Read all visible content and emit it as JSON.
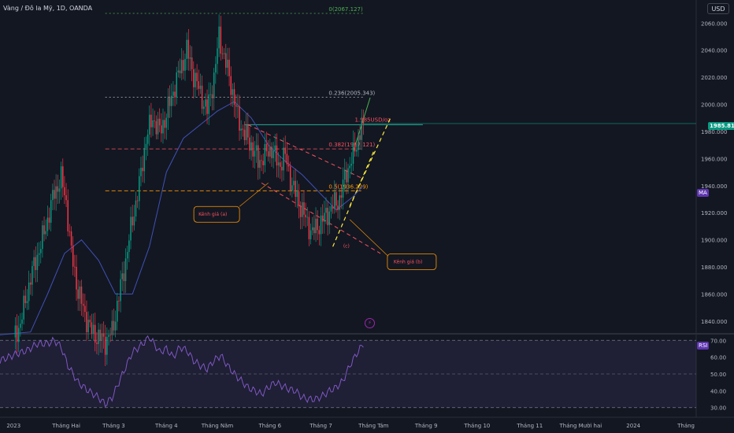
{
  "header": {
    "title": "Vàng / Đô la Mỹ, 1D, OANDA",
    "currency_button": "USD"
  },
  "badges": {
    "price": "1985.810",
    "ma": "MA",
    "rsi": "RSI"
  },
  "colors": {
    "background": "#131722",
    "up": "#089981",
    "down": "#f23645",
    "ma_line": "#3f51b5",
    "rsi_line": "#7e57c2",
    "fib": "#f7525f",
    "channel": "#ff9800",
    "rsi_band": "#2a2e39"
  },
  "chart_data": [
    {
      "type": "candlestick",
      "title": "Vàng / Đô la Mỹ, 1D, OANDA",
      "y_ticks": [
        1840,
        1860,
        1880,
        1900,
        1920,
        1940,
        1960,
        1980,
        2000,
        2020,
        2040,
        2060
      ],
      "y_tick_labels": [
        "1840.000",
        "1860.000",
        "1880.000",
        "1900.000",
        "1920.000",
        "1940.000",
        "1960.000",
        "1980.000",
        "2000.000",
        "2020.000",
        "2040.000",
        "2060.000"
      ],
      "ylim": [
        1833,
        2077
      ],
      "x_tick_labels": [
        "2023",
        "Tháng Hai",
        "Tháng 3",
        "Tháng 4",
        "Tháng Năm",
        "Tháng 6",
        "Tháng 7",
        "Tháng Tám",
        "Tháng 9",
        "Tháng 10",
        "Tháng 11",
        "Tháng Mười hai",
        "2024",
        "Tháng"
      ],
      "x_tick_days": [
        0,
        31,
        59,
        90,
        120,
        151,
        181,
        212,
        243,
        273,
        304,
        334,
        365,
        396
      ],
      "xlim": [
        -8,
        402
      ],
      "last_day": 206,
      "last_price": 1985.81,
      "price_anchors": [
        [
          0,
          1828
        ],
        [
          4,
          1838
        ],
        [
          10,
          1872
        ],
        [
          18,
          1905
        ],
        [
          24,
          1935
        ],
        [
          28,
          1945
        ],
        [
          31,
          1928
        ],
        [
          34,
          1890
        ],
        [
          38,
          1862
        ],
        [
          42,
          1845
        ],
        [
          46,
          1832
        ],
        [
          50,
          1828
        ],
        [
          54,
          1825
        ],
        [
          58,
          1832
        ],
        [
          62,
          1858
        ],
        [
          66,
          1885
        ],
        [
          70,
          1915
        ],
        [
          74,
          1940
        ],
        [
          78,
          1975
        ],
        [
          82,
          1990
        ],
        [
          86,
          1980
        ],
        [
          90,
          1992
        ],
        [
          94,
          2010
        ],
        [
          98,
          2025
        ],
        [
          102,
          2040
        ],
        [
          106,
          2022
        ],
        [
          110,
          2008
        ],
        [
          114,
          1995
        ],
        [
          118,
          2020
        ],
        [
          121,
          2050
        ],
        [
          124,
          2035
        ],
        [
          128,
          2015
        ],
        [
          132,
          1990
        ],
        [
          136,
          1978
        ],
        [
          140,
          1970
        ],
        [
          144,
          1958
        ],
        [
          148,
          1962
        ],
        [
          152,
          1968
        ],
        [
          156,
          1955
        ],
        [
          160,
          1962
        ],
        [
          164,
          1940
        ],
        [
          168,
          1928
        ],
        [
          172,
          1915
        ],
        [
          176,
          1905
        ],
        [
          180,
          1912
        ],
        [
          184,
          1918
        ],
        [
          188,
          1925
        ],
        [
          192,
          1930
        ],
        [
          196,
          1950
        ],
        [
          200,
          1962
        ],
        [
          204,
          1980
        ],
        [
          206,
          1985.81
        ]
      ],
      "ma_anchors": [
        [
          -8,
          1830
        ],
        [
          10,
          1832
        ],
        [
          20,
          1860
        ],
        [
          30,
          1890
        ],
        [
          40,
          1900
        ],
        [
          50,
          1885
        ],
        [
          60,
          1860
        ],
        [
          70,
          1860
        ],
        [
          80,
          1895
        ],
        [
          90,
          1950
        ],
        [
          100,
          1975
        ],
        [
          110,
          1985
        ],
        [
          120,
          1995
        ],
        [
          130,
          2002
        ],
        [
          140,
          1990
        ],
        [
          150,
          1970
        ],
        [
          160,
          1958
        ],
        [
          170,
          1948
        ],
        [
          180,
          1935
        ],
        [
          190,
          1922
        ],
        [
          200,
          1932
        ],
        [
          206,
          1940
        ]
      ],
      "levels": [
        {
          "label": "0(2067.127)",
          "value": 2067.127,
          "day_from": 54,
          "day_to": 206,
          "color": "#4caf50",
          "style": "dotted"
        },
        {
          "label": "0.236(2005.343)",
          "value": 2005.343,
          "day_from": 54,
          "day_to": 206,
          "color": "#b2b5be",
          "style": "dotted"
        },
        {
          "label": "0.382(1967.121)",
          "value": 1967.121,
          "day_from": 54,
          "day_to": 206,
          "color": "#f7525f",
          "style": "dashed"
        },
        {
          "label": "0.5(1936.229)",
          "value": 1936.229,
          "day_from": 54,
          "day_to": 206,
          "color": "#ff9800",
          "style": "dashed"
        }
      ],
      "horizontal_line": {
        "label": "1.985USD/oz",
        "value": 1985.0,
        "day_from": 136,
        "day_to": 241
      },
      "annotations": [
        {
          "label": "Kênh giá (a)",
          "box_day": 108,
          "box_price": 1920
        },
        {
          "label": "Kênh giá (b)",
          "box_day": 222,
          "box_price": 1885
        },
        {
          "label": "(c)",
          "day": 196,
          "price": 1899
        }
      ]
    },
    {
      "type": "line",
      "name": "RSI",
      "y_ticks": [
        30,
        40,
        50,
        60,
        70
      ],
      "y_tick_labels": [
        "30.00",
        "40.00",
        "50.00",
        "60.00",
        "70.00"
      ],
      "ylim": [
        28,
        72
      ],
      "band": [
        30,
        70
      ],
      "rsi_anchors": [
        [
          -8,
          58
        ],
        [
          2,
          62
        ],
        [
          8,
          64
        ],
        [
          14,
          68
        ],
        [
          20,
          68
        ],
        [
          24,
          70
        ],
        [
          28,
          66
        ],
        [
          32,
          55
        ],
        [
          38,
          45
        ],
        [
          44,
          40
        ],
        [
          50,
          36
        ],
        [
          54,
          32
        ],
        [
          58,
          36
        ],
        [
          62,
          45
        ],
        [
          66,
          54
        ],
        [
          70,
          63
        ],
        [
          74,
          66
        ],
        [
          80,
          72
        ],
        [
          86,
          63
        ],
        [
          90,
          65
        ],
        [
          94,
          60
        ],
        [
          98,
          66
        ],
        [
          102,
          64
        ],
        [
          106,
          58
        ],
        [
          110,
          55
        ],
        [
          114,
          53
        ],
        [
          118,
          58
        ],
        [
          122,
          61
        ],
        [
          126,
          55
        ],
        [
          130,
          50
        ],
        [
          134,
          46
        ],
        [
          138,
          42
        ],
        [
          142,
          40
        ],
        [
          146,
          38
        ],
        [
          150,
          42
        ],
        [
          154,
          45
        ],
        [
          158,
          43
        ],
        [
          162,
          41
        ],
        [
          166,
          40
        ],
        [
          170,
          36
        ],
        [
          174,
          35
        ],
        [
          178,
          35
        ],
        [
          182,
          37
        ],
        [
          186,
          40
        ],
        [
          190,
          42
        ],
        [
          194,
          46
        ],
        [
          198,
          55
        ],
        [
          202,
          62
        ],
        [
          206,
          68
        ]
      ]
    }
  ]
}
